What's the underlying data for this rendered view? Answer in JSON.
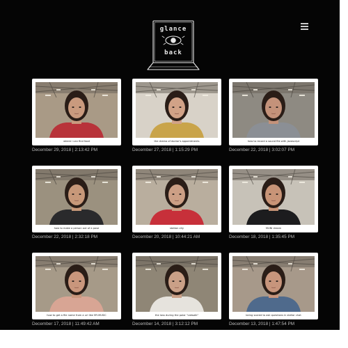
{
  "logo": {
    "text_top": "glance",
    "text_bottom": "back"
  },
  "header": {
    "menu_icon": "hamburger-menu-icon"
  },
  "entries": [
    {
      "caption": "where i can find food",
      "timestamp": "December 29, 2018 | 2:13:42 PM",
      "shirt": "#b8333a",
      "bg": "#a99a86"
    },
    {
      "caption": "the drama of doctor's appointments",
      "timestamp": "December 27, 2018 | 1:15:29 PM",
      "shirt": "#c9a44a",
      "bg": "#d8d2c8"
    },
    {
      "caption": "how to record a sound file with javascript",
      "timestamp": "December 22, 2018 | 3:02:07 PM",
      "shirt": "#8b8f95",
      "bg": "#8e8a82"
    },
    {
      "caption": "how to make a person out of a pose",
      "timestamp": "December 22, 2018 | 2:32:18 PM",
      "shirt": "#2a2a2c",
      "bg": "#9b917f"
    },
    {
      "caption": "station city",
      "timestamp": "December 20, 2018 | 10:44:21 AM",
      "shirt": "#c7303a",
      "bg": "#b9ae9e"
    },
    {
      "caption": "MUNI dream",
      "timestamp": "December 18, 2018 | 1:35:45 PM",
      "shirt": "#1c1c1e",
      "bg": "#c7c2b8"
    },
    {
      "caption": "how to get a file name from a url like MY-MUSIC",
      "timestamp": "December 17, 2018 | 11:49:42 AM",
      "shirt": "#d8a594",
      "bg": "#a69a88"
    },
    {
      "caption": "the loss during the polar \"catwalk\"",
      "timestamp": "December 14, 2018 | 3:12:12 PM",
      "shirt": "#e6e3dd",
      "bg": "#8f8676"
    },
    {
      "caption": "being scared to ask questions in stellar chat",
      "timestamp": "December 13, 2018 | 1:47:54 PM",
      "shirt": "#4f6a8c",
      "bg": "#a7998a"
    }
  ]
}
